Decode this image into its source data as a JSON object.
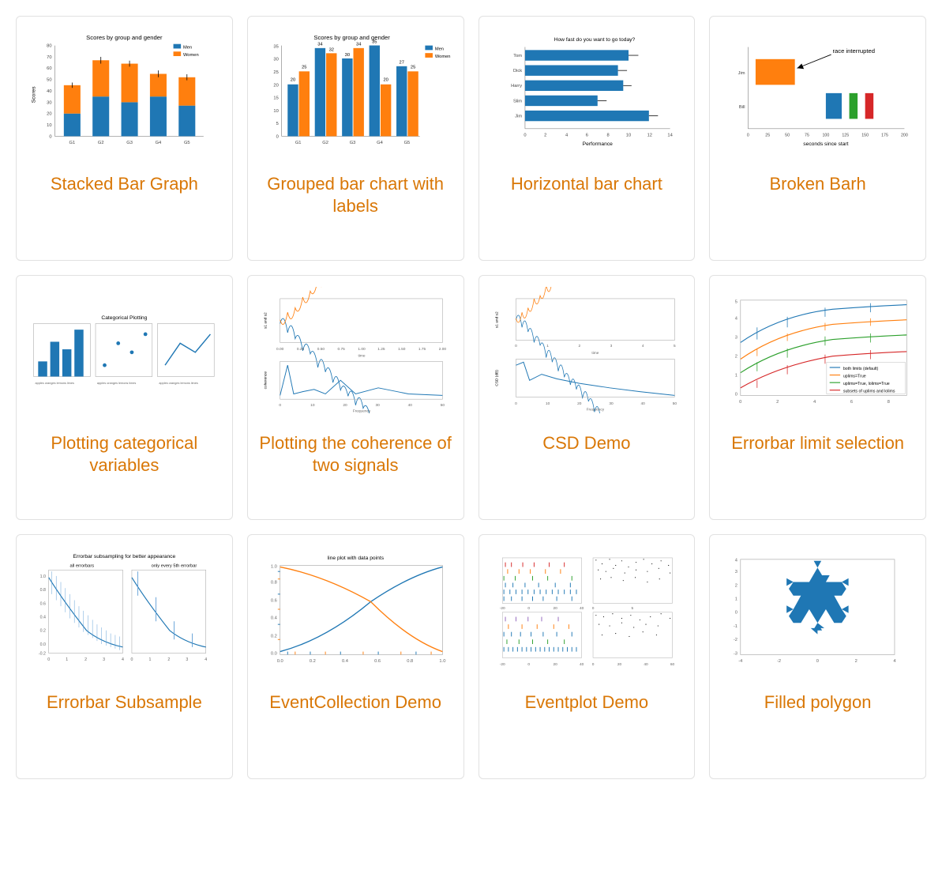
{
  "gallery": {
    "items": [
      {
        "title": "Stacked Bar Graph",
        "thumb_title": "Scores by group and gender",
        "thumb_ylabel": "Scores",
        "thumb_legend": [
          "Men",
          "Women"
        ],
        "chart_data": {
          "type": "bar",
          "stacked": true,
          "categories": [
            "G1",
            "G2",
            "G3",
            "G4",
            "G5"
          ],
          "series": [
            {
              "name": "Men",
              "values": [
                20,
                35,
                30,
                35,
                27
              ]
            },
            {
              "name": "Women",
              "values": [
                25,
                32,
                34,
                20,
                25
              ]
            }
          ],
          "title": "Scores by group and gender",
          "ylabel": "Scores",
          "ylim": [
            0,
            80
          ]
        }
      },
      {
        "title": "Grouped bar chart with labels",
        "thumb_title": "Scores by group and gender",
        "thumb_legend": [
          "Men",
          "Women"
        ],
        "chart_data": {
          "type": "bar",
          "grouped": true,
          "categories": [
            "G1",
            "G2",
            "G3",
            "G4",
            "G5"
          ],
          "series": [
            {
              "name": "Men",
              "values": [
                20,
                34,
                30,
                35,
                27
              ]
            },
            {
              "name": "Women",
              "values": [
                25,
                32,
                34,
                20,
                25
              ]
            }
          ],
          "title": "Scores by group and gender",
          "ylim": [
            0,
            35
          ]
        }
      },
      {
        "title": "Horizontal bar chart",
        "thumb_title": "How fast do you want to go today?",
        "thumb_xlabel": "Performance",
        "chart_data": {
          "type": "bar",
          "orientation": "horizontal",
          "categories": [
            "Tom",
            "Dick",
            "Harry",
            "Slim",
            "Jim"
          ],
          "values": [
            10,
            9,
            9.5,
            7,
            12
          ],
          "title": "How fast do you want to go today?",
          "xlabel": "Performance",
          "xlim": [
            0,
            14
          ]
        }
      },
      {
        "title": "Broken Barh",
        "thumb_annotation": "race interrupted",
        "thumb_xlabel": "seconds since start",
        "chart_data": {
          "type": "broken_barh",
          "rows": [
            {
              "label": "Jim",
              "segments": [
                {
                  "start": 10,
                  "width": 50,
                  "color": "#ff7f0e"
                }
              ]
            },
            {
              "label": "Bill",
              "segments": [
                {
                  "start": 100,
                  "width": 20,
                  "color": "#1f77b4"
                },
                {
                  "start": 130,
                  "width": 10,
                  "color": "#2ca02c"
                },
                {
                  "start": 150,
                  "width": 10,
                  "color": "#d62728"
                }
              ]
            }
          ],
          "xlabel": "seconds since start",
          "xlim": [
            0,
            200
          ],
          "xticks": [
            0,
            25,
            50,
            75,
            100,
            125,
            150,
            175,
            200
          ],
          "annotation": "race interrupted"
        }
      },
      {
        "title": "Plotting categorical variables",
        "thumb_title": "Categorical Plotting",
        "chart_data": {
          "type": "categorical",
          "categories": [
            "apples",
            "oranges",
            "lemons",
            "limes"
          ],
          "bar_values": [
            10,
            25,
            20,
            35
          ],
          "scatter_values": [
            10,
            25,
            20,
            30
          ],
          "line_values": [
            10,
            25,
            20,
            30
          ],
          "title": "Categorical Plotting"
        }
      },
      {
        "title": "Plotting the coherence of two signals",
        "chart_data": {
          "type": "line",
          "subplots": [
            {
              "ylabel": "s1 and s2",
              "xlabel": "time",
              "xlim": [
                0,
                2
              ],
              "xticks": [
                0.0,
                0.25,
                0.5,
                0.75,
                1.0,
                1.25,
                1.5,
                1.75,
                2.0
              ],
              "series": [
                {
                  "name": "s1"
                },
                {
                  "name": "s2"
                }
              ]
            },
            {
              "ylabel": "coherence",
              "xlabel": "Frequency",
              "xlim": [
                0,
                50
              ],
              "ylim": [
                0,
                1
              ],
              "xticks": [
                0,
                10,
                20,
                30,
                40,
                50
              ]
            }
          ]
        }
      },
      {
        "title": "CSD Demo",
        "chart_data": {
          "type": "line",
          "subplots": [
            {
              "ylabel": "s1 and s2",
              "xlabel": "time",
              "xlim": [
                0,
                5
              ],
              "ylim": [
                -0.05,
                0.05
              ],
              "series": [
                {
                  "name": "s1"
                },
                {
                  "name": "s2"
                }
              ]
            },
            {
              "ylabel": "CSD (dB)",
              "xlabel": "Frequency",
              "xlim": [
                0,
                50
              ],
              "xticks": [
                0,
                10,
                20,
                30,
                40,
                50
              ]
            }
          ]
        }
      },
      {
        "title": "Errorbar limit selection",
        "thumb_legend": [
          "both limits (default)",
          "uplims=True",
          "uplims=True, lolims=True",
          "subsets of uplims and lolims"
        ],
        "chart_data": {
          "type": "line",
          "xlim": [
            0,
            9
          ],
          "ylim": [
            0,
            5
          ],
          "series": [
            {
              "name": "both limits (default)",
              "color": "#1f77b4"
            },
            {
              "name": "uplims=True",
              "color": "#ff7f0e"
            },
            {
              "name": "uplims=True, lolims=True",
              "color": "#2ca02c"
            },
            {
              "name": "subsets of uplims and lolims",
              "color": "#d62728"
            }
          ]
        }
      },
      {
        "title": "Errorbar Subsample",
        "thumb_title": "Errorbar subsampling for better appearance",
        "thumb_subtitles": [
          "all errorbars",
          "only every 5th errorbar"
        ],
        "chart_data": {
          "type": "line",
          "title": "Errorbar subsampling for better appearance",
          "xlim": [
            0,
            4
          ],
          "ylim": [
            -0.2,
            1.0
          ],
          "yticks": [
            -0.2,
            0.0,
            0.2,
            0.4,
            0.6,
            0.8,
            1.0
          ]
        }
      },
      {
        "title": "EventCollection Demo",
        "thumb_title": "line plot with data points",
        "chart_data": {
          "type": "line",
          "title": "line plot with data points",
          "xlim": [
            0,
            1
          ],
          "ylim": [
            0,
            1
          ],
          "xticks": [
            0.0,
            0.2,
            0.4,
            0.6,
            0.8,
            1.0
          ],
          "yticks": [
            0.0,
            0.2,
            0.4,
            0.6,
            0.8,
            1.0
          ]
        }
      },
      {
        "title": "Eventplot Demo",
        "chart_data": {
          "type": "eventplot",
          "subplots": 4,
          "ylim": [
            -0.5,
            5.5
          ]
        }
      },
      {
        "title": "Filled polygon",
        "chart_data": {
          "type": "polygon",
          "shape": "koch_snowflake",
          "xlim": [
            -4,
            4
          ],
          "ylim": [
            -3,
            4
          ]
        }
      }
    ]
  }
}
